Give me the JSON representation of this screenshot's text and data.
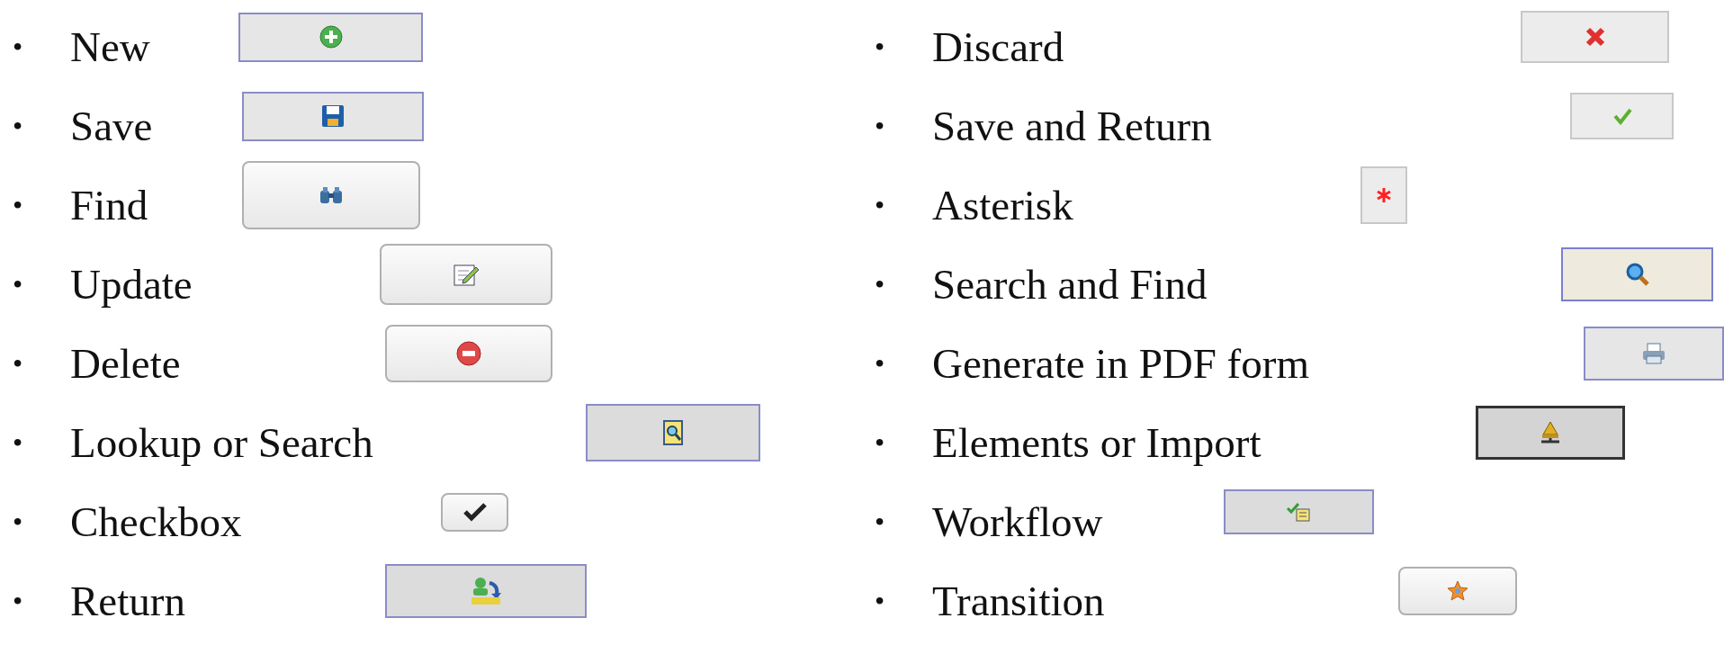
{
  "left": [
    {
      "bullet": "•",
      "label": "New",
      "kind": "flat"
    },
    {
      "bullet": "•",
      "label": "Save",
      "kind": "flat"
    },
    {
      "bullet": "•",
      "label": "Find",
      "kind": "rounded"
    },
    {
      "bullet": "•",
      "label": "Update",
      "kind": "rounded"
    },
    {
      "bullet": "•",
      "label": "Delete",
      "kind": "rounded"
    },
    {
      "bullet": "•",
      "label": "Lookup or Search",
      "kind": "grey"
    },
    {
      "bullet": "•",
      "label": "Checkbox",
      "kind": "rounded"
    },
    {
      "bullet": "•",
      "label": "Return",
      "kind": "grey"
    }
  ],
  "right": [
    {
      "bullet": "•",
      "label": "Discard",
      "kind": "plain"
    },
    {
      "bullet": "•",
      "label": "Save and Return",
      "kind": "plain"
    },
    {
      "bullet": "•",
      "label": "Asterisk",
      "kind": "plain"
    },
    {
      "bullet": "•",
      "label": "Search and Find",
      "kind": "beige"
    },
    {
      "bullet": "•",
      "label": "Generate in PDF form",
      "kind": "flat"
    },
    {
      "bullet": "•",
      "label": "Elements or Import",
      "kind": "dark"
    },
    {
      "bullet": "•",
      "label": "Workflow",
      "kind": "grey"
    },
    {
      "bullet": "•",
      "label": "Transition",
      "kind": "rounded"
    }
  ]
}
